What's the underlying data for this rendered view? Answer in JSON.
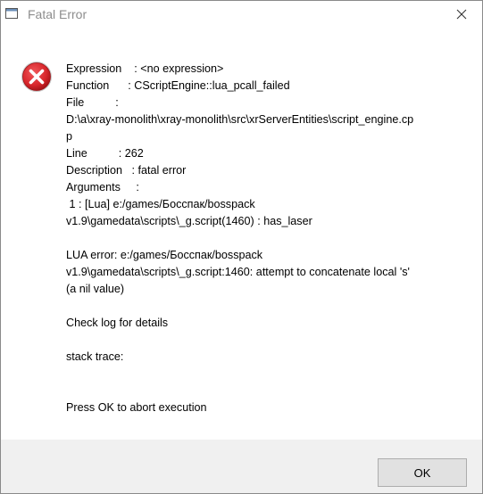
{
  "window": {
    "title": "Fatal Error"
  },
  "message": {
    "lines": [
      "Expression    : <no expression>",
      "Function      : CScriptEngine::lua_pcall_failed",
      "File          :",
      "D:\\a\\xray-monolith\\xray-monolith\\src\\xrServerEntities\\script_engine.cp",
      "p",
      "Line          : 262",
      "Description   : fatal error",
      "Arguments     :",
      " 1 : [Lua] e:/games/Босспак/bosspack",
      "v1.9\\gamedata\\scripts\\_g.script(1460) : has_laser",
      "",
      "LUA error: e:/games/Босспак/bosspack",
      "v1.9\\gamedata\\scripts\\_g.script:1460: attempt to concatenate local 's'",
      "(a nil value)",
      "",
      "Check log for details",
      "",
      "stack trace:",
      "",
      "",
      "Press OK to abort execution"
    ]
  },
  "buttons": {
    "ok_label": "OK"
  },
  "icons": {
    "error": "error-icon",
    "close": "close-icon",
    "app": "app-window-icon"
  },
  "colors": {
    "error_red": "#d8262b",
    "footer_bg": "#f0f0f0",
    "button_bg": "#e1e1e1",
    "button_border": "#adadad"
  }
}
